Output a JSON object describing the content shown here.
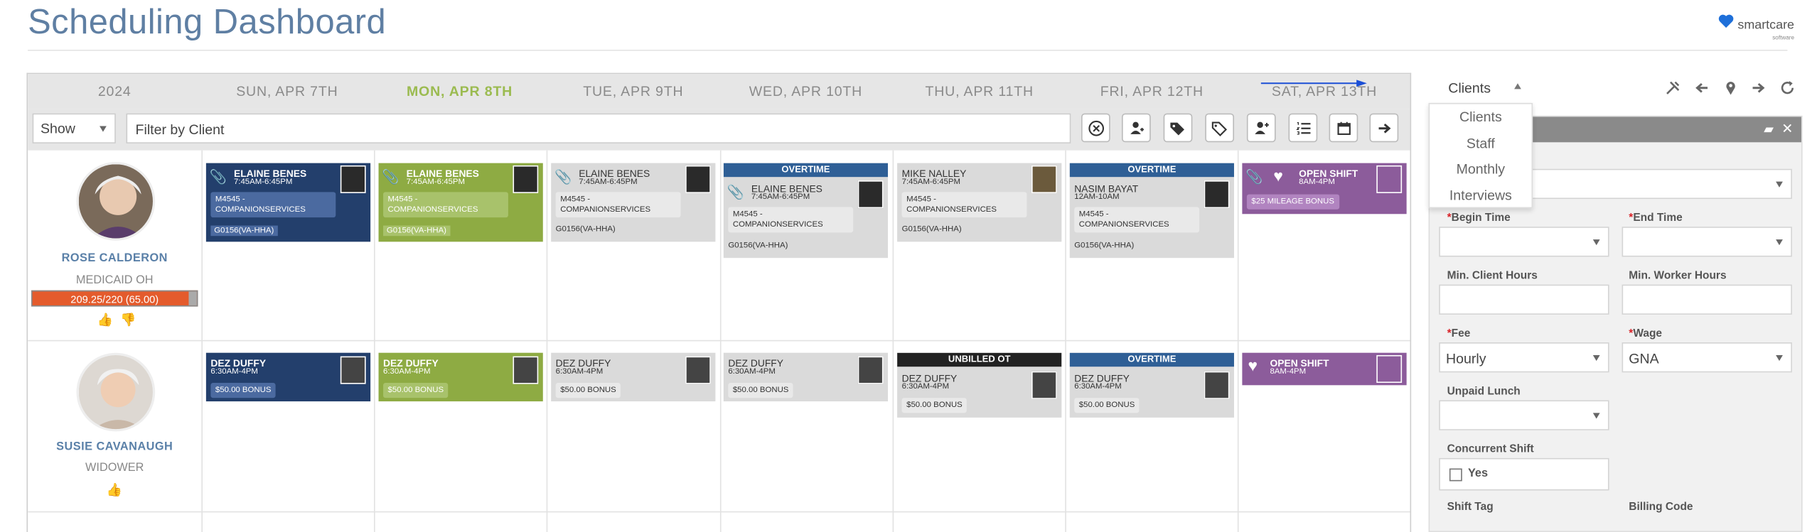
{
  "header": {
    "title": "Scheduling Dashboard",
    "logo_word": "smartcare",
    "logo_sub": "software"
  },
  "days": [
    {
      "label": "2024",
      "today": false
    },
    {
      "label": "SUN, APR 7TH",
      "today": false
    },
    {
      "label": "MON, APR 8TH",
      "today": true
    },
    {
      "label": "TUE, APR 9TH",
      "today": false
    },
    {
      "label": "WED, APR 10TH",
      "today": false
    },
    {
      "label": "THU, APR 11TH",
      "today": false
    },
    {
      "label": "FRI, APR 12TH",
      "today": false
    },
    {
      "label": "SAT, APR 13TH",
      "today": false
    }
  ],
  "toolbar": {
    "show_label": "Show",
    "filter_placeholder": "Filter by Client",
    "buttons": [
      "clear-filter",
      "assign-staff",
      "tags",
      "bonus-tags",
      "add-staff",
      "list",
      "calendar",
      "next"
    ]
  },
  "clients": [
    {
      "name": "ROSE CALDERON",
      "subtitle": "MEDICAID OH",
      "budget": "209.25/220 (65.00)",
      "thumbs": [
        "thumbs-up",
        "thumbs-down"
      ]
    },
    {
      "name": "SUSIE CAVANAUGH",
      "subtitle": "WIDOWER",
      "thumbs": [
        "thumbs-up"
      ]
    }
  ],
  "shifts_row1": [
    {
      "name": "ELAINE BENES",
      "time": "7:45AM-6:45PM",
      "service": "M4545 - COMPANIONSERVICES",
      "code": "G0156(VA-HHA)",
      "color": "navy"
    },
    {
      "name": "ELAINE BENES",
      "time": "7:45AM-6:45PM",
      "service": "M4545 - COMPANIONSERVICES",
      "code": "G0156(VA-HHA)",
      "color": "green"
    },
    {
      "name": "ELAINE BENES",
      "time": "7:45AM-6:45PM",
      "service": "M4545 - COMPANIONSERVICES",
      "code": "G0156(VA-HHA)",
      "color": "gray"
    },
    {
      "banner": "OVERTIME",
      "name": "ELAINE BENES",
      "time": "7:45AM-6:45PM",
      "service": "M4545 - COMPANIONSERVICES",
      "code": "G0156(VA-HHA)",
      "color": "gray"
    },
    {
      "name": "MIKE NALLEY",
      "time": "7:45AM-6:45PM",
      "service": "M4545 - COMPANIONSERVICES",
      "code": "G0156(VA-HHA)",
      "color": "gray"
    },
    {
      "banner": "OVERTIME",
      "name": "NASIM BAYAT",
      "time": "12AM-10AM",
      "service": "M4545 - COMPANIONSERVICES",
      "code": "G0156(VA-HHA)",
      "color": "gray"
    },
    {
      "name": "OPEN SHIFT",
      "time": "8AM-4PM",
      "tag": "$25 MILEAGE BONUS",
      "color": "purple"
    }
  ],
  "shifts_row2": [
    {
      "name": "DEZ DUFFY",
      "time": "6:30AM-4PM",
      "bonus": "$50.00 BONUS",
      "color": "navy"
    },
    {
      "name": "DEZ DUFFY",
      "time": "6:30AM-4PM",
      "bonus": "$50.00 BONUS",
      "color": "green"
    },
    {
      "name": "DEZ DUFFY",
      "time": "6:30AM-4PM",
      "bonus": "$50.00 BONUS",
      "color": "gray"
    },
    {
      "name": "DEZ DUFFY",
      "time": "6:30AM-4PM",
      "bonus": "$50.00 BONUS",
      "color": "gray"
    },
    {
      "banner": "UNBILLED OT",
      "name": "DEZ DUFFY",
      "time": "6:30AM-4PM",
      "bonus": "$50.00 BONUS",
      "color": "gray"
    },
    {
      "banner": "OVERTIME",
      "name": "DEZ DUFFY",
      "time": "6:30AM-4PM",
      "bonus": "$50.00 BONUS",
      "color": "gray"
    },
    {
      "name": "OPEN SHIFT",
      "time": "8AM-4PM",
      "color": "purple"
    }
  ],
  "right": {
    "selector_value": "Clients",
    "dropdown": [
      "Clients",
      "Staff",
      "Monthly",
      "Interviews"
    ],
    "icons": [
      "tools-icon",
      "arrow-left-icon",
      "map-pin-icon",
      "arrow-right-icon",
      "refresh-icon"
    ]
  },
  "form": {
    "begin_time": "Begin Time",
    "end_time": "End Time",
    "min_client_hours": "Min. Client Hours",
    "min_worker_hours": "Min. Worker Hours",
    "fee_label": "Fee",
    "fee_value": "Hourly",
    "wage_label": "Wage",
    "wage_value": "GNA",
    "unpaid_lunch": "Unpaid Lunch",
    "concurrent_shift": "Concurrent Shift",
    "yes_label": "Yes",
    "shift_tag": "Shift Tag",
    "billing_code": "Billing Code"
  },
  "colors": {
    "navy": "#233f6c",
    "green": "#8eab43",
    "gray": "#dadada",
    "purple": "#8c5c9b",
    "overtime": "#2f5f96",
    "unbilled": "#222222",
    "budget": "#e45b2c",
    "title": "#5f7fa3"
  }
}
